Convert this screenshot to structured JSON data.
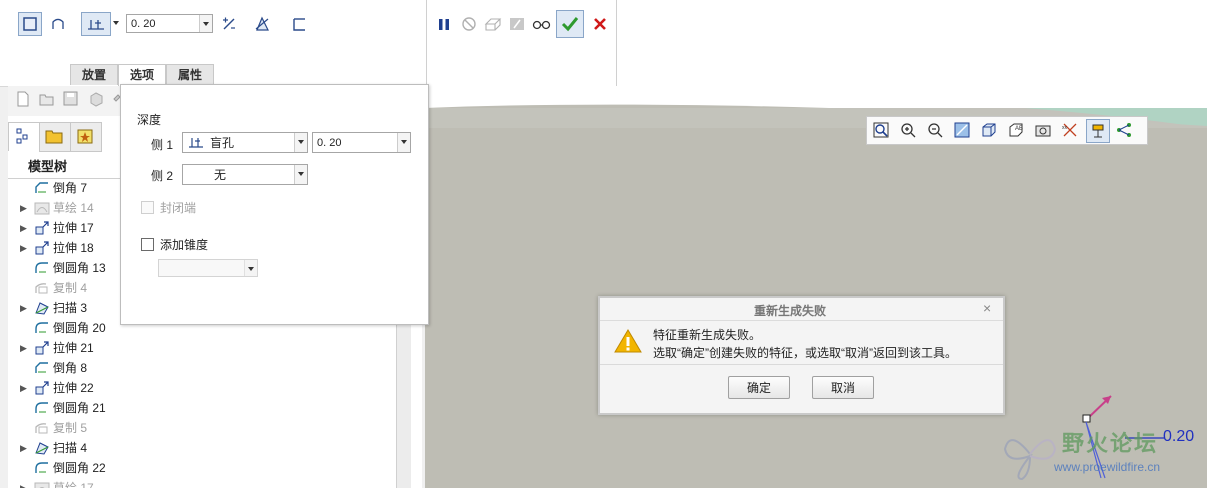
{
  "dashboard": {
    "depth_value": "0. 20",
    "tabs": [
      "放置",
      "选项",
      "属性"
    ],
    "active_tab": 1
  },
  "options": {
    "depth_label": "深度",
    "side1_label": "侧 1",
    "side1_type": "盲孔",
    "side1_value": "0. 20",
    "side2_label": "侧 2",
    "side2_type": "无",
    "cap_ends_label": "封闭端",
    "add_taper_label": "添加锥度"
  },
  "tree": {
    "header": "模型树",
    "items": [
      {
        "label": "倒角 7",
        "expand": false,
        "dim": false,
        "icon": "chamfer-icon"
      },
      {
        "label": "草绘 14",
        "expand": true,
        "dim": true,
        "icon": "sketch-icon"
      },
      {
        "label": "拉伸 17",
        "expand": true,
        "dim": false,
        "icon": "extrude-icon"
      },
      {
        "label": "拉伸 18",
        "expand": true,
        "dim": false,
        "icon": "extrude-icon"
      },
      {
        "label": "倒圆角 13",
        "expand": false,
        "dim": false,
        "icon": "round-icon"
      },
      {
        "label": "复制 4",
        "expand": false,
        "dim": true,
        "icon": "copy-icon"
      },
      {
        "label": "扫描 3",
        "expand": true,
        "dim": false,
        "icon": "sweep-icon"
      },
      {
        "label": "倒圆角 20",
        "expand": false,
        "dim": false,
        "icon": "round-icon"
      },
      {
        "label": "拉伸 21",
        "expand": true,
        "dim": false,
        "icon": "extrude-icon"
      },
      {
        "label": "倒角 8",
        "expand": false,
        "dim": false,
        "icon": "chamfer-icon"
      },
      {
        "label": "拉伸 22",
        "expand": true,
        "dim": false,
        "icon": "extrude-icon"
      },
      {
        "label": "倒圆角 21",
        "expand": false,
        "dim": false,
        "icon": "round-icon"
      },
      {
        "label": "复制 5",
        "expand": false,
        "dim": true,
        "icon": "copy-icon"
      },
      {
        "label": "扫描 4",
        "expand": true,
        "dim": false,
        "icon": "sweep-icon"
      },
      {
        "label": "倒圆角 22",
        "expand": false,
        "dim": false,
        "icon": "round-icon"
      },
      {
        "label": "草绘 17",
        "expand": true,
        "dim": true,
        "icon": "sketch-icon"
      }
    ]
  },
  "dialog": {
    "title": "重新生成失败",
    "line1": "特征重新生成失败。",
    "line2": "选取“确定”创建失败的特征，或选取“取消”返回到该工具。",
    "ok": "确定",
    "cancel": "取消"
  },
  "graphics": {
    "dimension_value": "0.20"
  },
  "watermark": {
    "title": "野火论坛",
    "url": "www.proewildfire.cn"
  },
  "colors": {
    "accept_green": "#2e9a2e",
    "cancel_red": "#d01818",
    "pause_blue": "#1f3f8f",
    "warning_yellow": "#f2b500",
    "background_teal": "#8ee6c8",
    "graphics_gray": "#bdbcb3"
  }
}
